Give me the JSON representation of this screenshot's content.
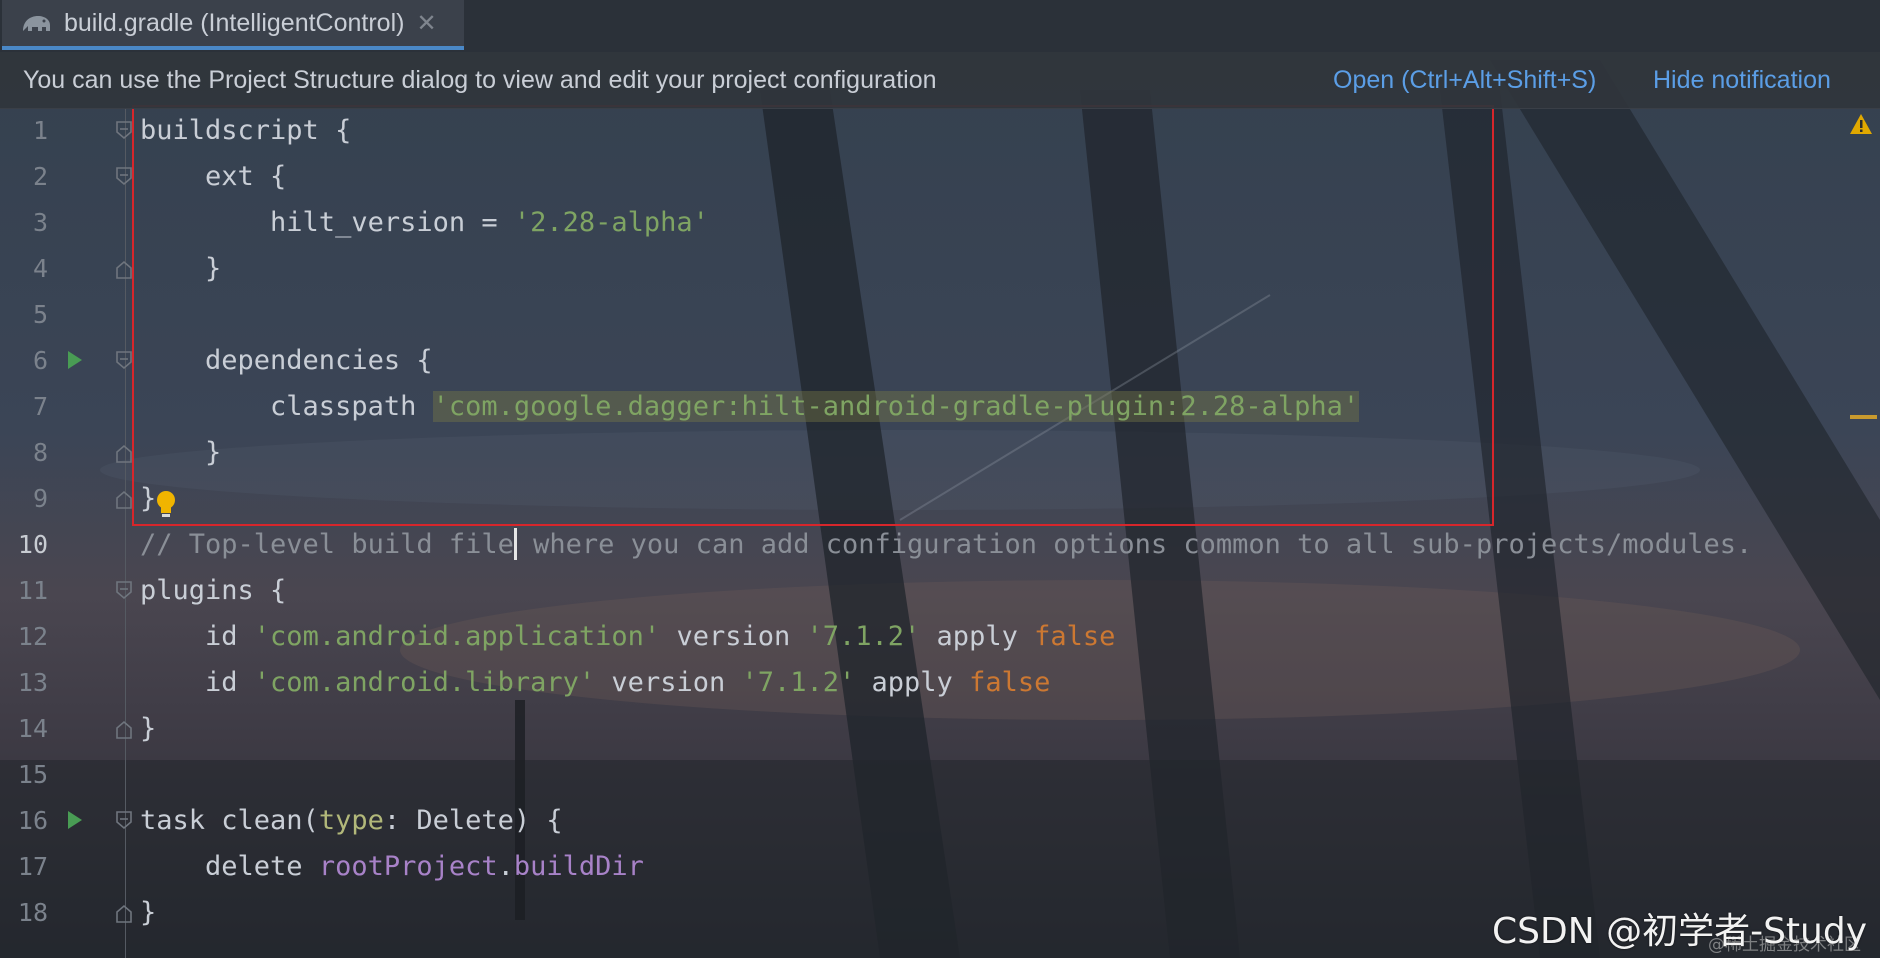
{
  "tab": {
    "title": "build.gradle (IntelligentControl)",
    "close": "✕"
  },
  "notification": {
    "message": "You can use the Project Structure dialog to view and edit your project configuration",
    "open_link": "Open (Ctrl+Alt+Shift+S)",
    "hide_link": "Hide notification"
  },
  "editor": {
    "current_line": 10,
    "lines": [
      {
        "n": "1",
        "t1": "buildscript {"
      },
      {
        "n": "2",
        "t1": "    ext {"
      },
      {
        "n": "3",
        "t1": "        hilt_version = ",
        "s1": "'2.28-alpha'"
      },
      {
        "n": "4",
        "t1": "    }"
      },
      {
        "n": "5",
        "t1": ""
      },
      {
        "n": "6",
        "t1": "    dependencies {"
      },
      {
        "n": "7",
        "t1": "        classpath ",
        "hl": "'com.google.dagger:hilt-android-gradle-plugin:2.28-alpha'"
      },
      {
        "n": "8",
        "t1": "    }"
      },
      {
        "n": "9",
        "t1": "}"
      },
      {
        "n": "10",
        "c1": "// Top-level build file",
        "c2": " where you can add configuration options common to all sub-projects/modules."
      },
      {
        "n": "11",
        "t1": "plugins {"
      },
      {
        "n": "12",
        "t1": "    id ",
        "s1": "'com.android.application'",
        "t2": " version ",
        "s2": "'7.1.2'",
        "t3": " apply ",
        "f": "false"
      },
      {
        "n": "13",
        "t1": "    id ",
        "s1": "'com.android.library'",
        "t2": " version ",
        "s2": "'7.1.2'",
        "t3": " apply ",
        "f": "false"
      },
      {
        "n": "14",
        "t1": "}"
      },
      {
        "n": "15",
        "t1": ""
      },
      {
        "n": "16",
        "t1": "task clean(",
        "p": "type",
        "t2": ": Delete) {"
      },
      {
        "n": "17",
        "t1": "    delete ",
        "u1": "rootProject",
        "t2": ".",
        "u2": "buildDir"
      },
      {
        "n": "18",
        "t1": "}"
      }
    ]
  },
  "watermark": "CSDN @初学者-Study",
  "watermark_small": "@稀土掘金技术社区",
  "icons": {
    "tab_file": "gradle-elephant-icon",
    "run": "run-gutter-icon",
    "fold": "fold-marker-icon",
    "bulb": "intention-bulb-icon",
    "warning": "warning-icon"
  },
  "colors": {
    "string": "#7fa463",
    "keyword": "#cc7832",
    "comment": "#8a8f97",
    "field": "#a882c8",
    "link": "#5b9ee6",
    "selection_box": "#d7262b",
    "tab_underline": "#4a88c7"
  }
}
